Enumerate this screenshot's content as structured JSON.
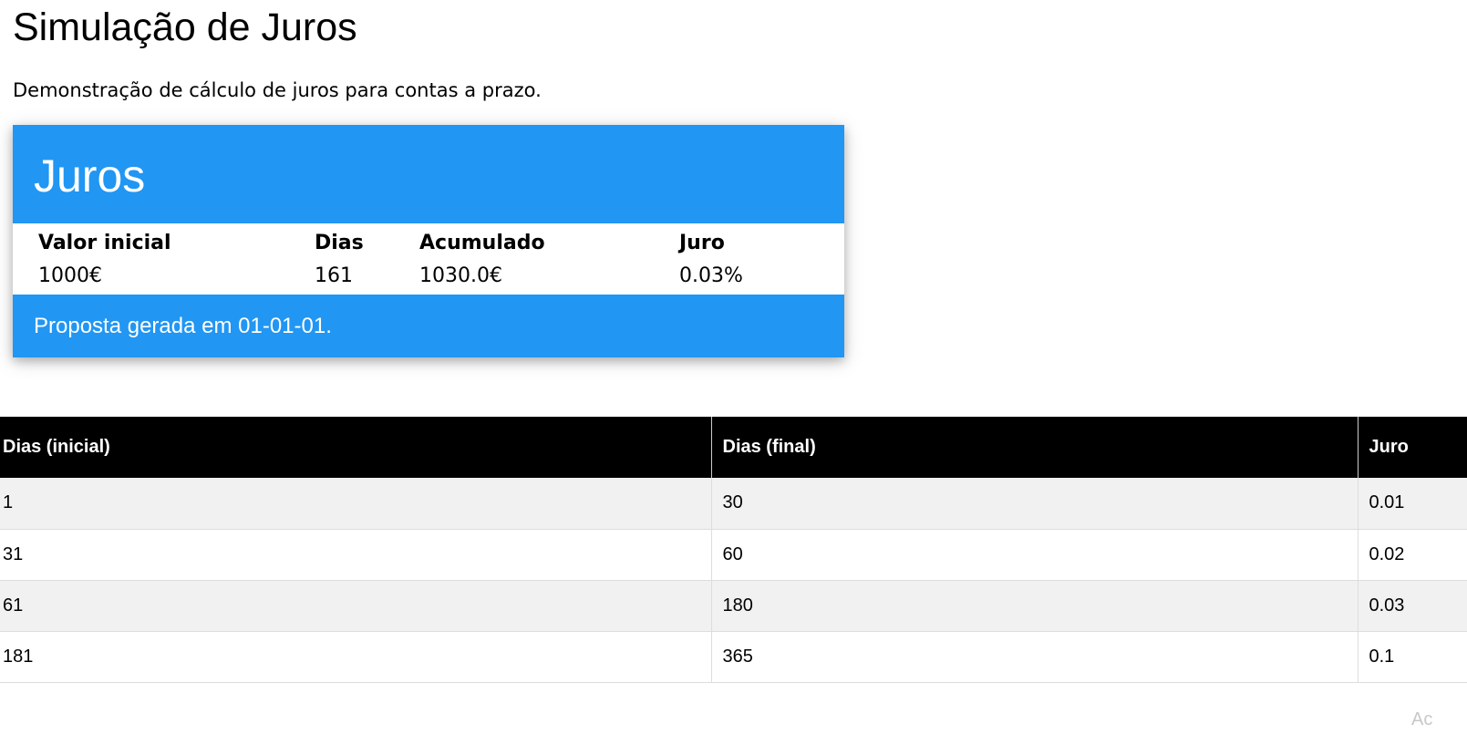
{
  "page": {
    "title": "Simulação de Juros",
    "subtitle": "Demonstração de cálculo de juros para contas a prazo."
  },
  "card": {
    "header": "Juros",
    "columns": [
      "Valor inicial",
      "Dias",
      "Acumulado",
      "Juro"
    ],
    "values": [
      "1000€",
      "161",
      "1030.0€",
      "0.03%"
    ],
    "footer": "Proposta gerada em 01-01-01.",
    "accent_color": "#2196F3"
  },
  "rates_table": {
    "headers": [
      "Dias (inicial)",
      "Dias (final)",
      "Juro"
    ],
    "rows": [
      [
        "1",
        "30",
        "0.01"
      ],
      [
        "31",
        "60",
        "0.02"
      ],
      [
        "61",
        "180",
        "0.03"
      ],
      [
        "181",
        "365",
        "0.1"
      ]
    ]
  },
  "watermark": {
    "text": "Ac"
  }
}
